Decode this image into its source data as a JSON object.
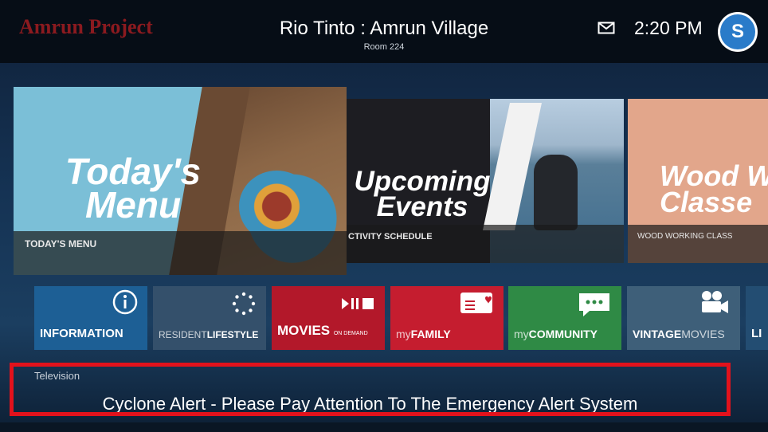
{
  "header": {
    "brand": "Amrun Project",
    "title": "Rio Tinto : Amrun Village",
    "subtitle": "Room 224",
    "time": "2:20 PM",
    "avatar_letter": "S",
    "mail_icon": "mail-icon"
  },
  "banners": [
    {
      "title_line1": "Today's",
      "title_line2": "Menu",
      "caption": "TODAY'S MENU"
    },
    {
      "title_line1": "Upcoming",
      "title_line2": "Events",
      "caption": "CTIVITY SCHEDULE"
    },
    {
      "title_line1": "Wood W",
      "title_line2": "Classe",
      "caption": "WOOD WORKING CLASS"
    }
  ],
  "tiles": {
    "information": {
      "label": "INFORMATION",
      "icon": "info-icon"
    },
    "resident": {
      "label_light": "RESIDENT",
      "label_bold": "LIFESTYLE",
      "icon": "dots-circle-icon"
    },
    "movies": {
      "label": "MOVIES",
      "sub": "ON DEMAND",
      "icon": "play-pause-stop-icon"
    },
    "family": {
      "label_light": "my",
      "label_bold": "FAMILY",
      "icon": "message-heart-icon"
    },
    "community": {
      "label_light": "my",
      "label_bold": "COMMUNITY",
      "icon": "chat-bubble-icon"
    },
    "vintage": {
      "label_bold": "VINTAGE",
      "label_light": "MOVIES",
      "icon": "film-camera-icon"
    },
    "live": {
      "label": "LI"
    }
  },
  "tv_label": "Television",
  "alert": "Cyclone Alert - Please Pay Attention To The Emergency Alert System",
  "colors": {
    "alert_border": "#e2121c",
    "brand": "#8b1a1f",
    "avatar": "#2a7bc9"
  }
}
